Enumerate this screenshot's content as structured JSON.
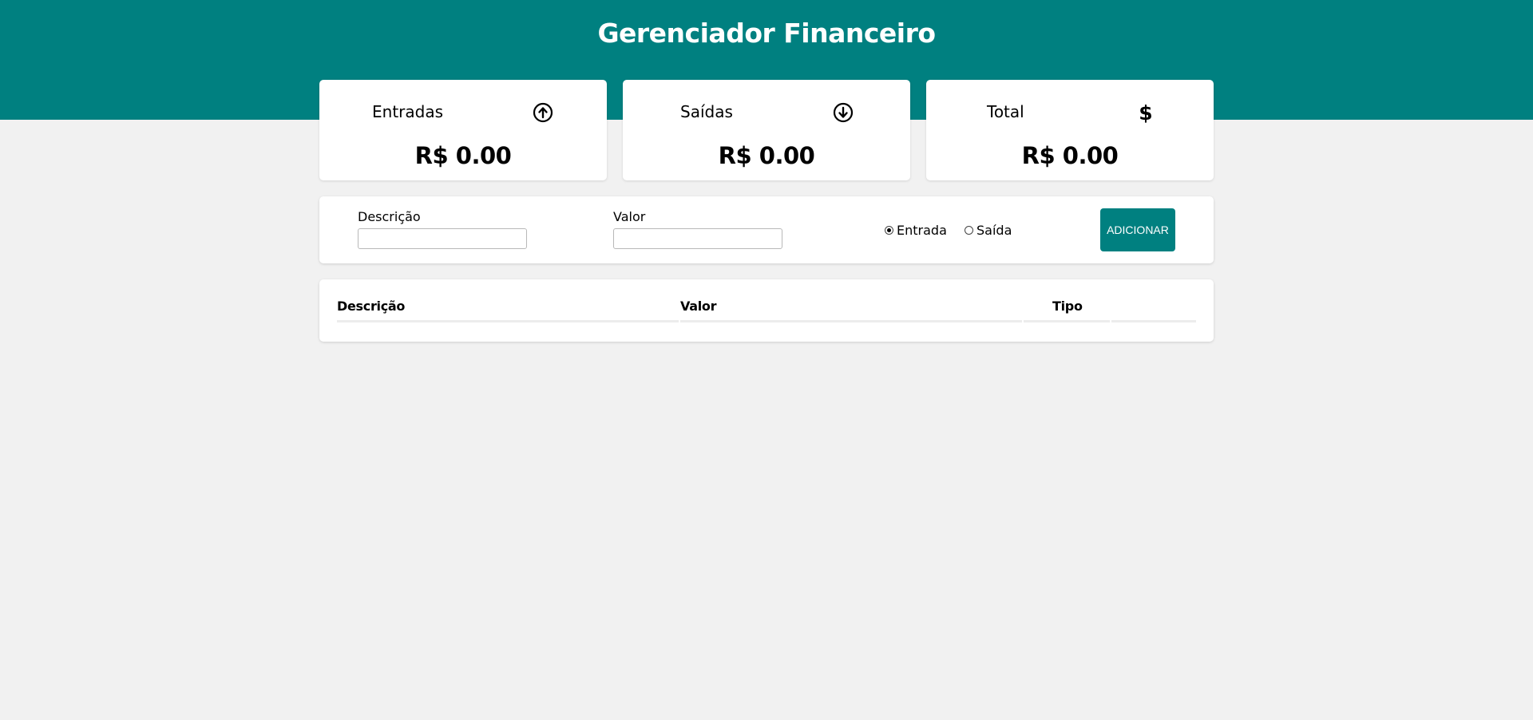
{
  "header": {
    "title": "Gerenciador Financeiro",
    "color": "#008080"
  },
  "summary": {
    "entradas": {
      "label": "Entradas",
      "value": "R$ 0.00",
      "icon": "arrow-up-circle-icon"
    },
    "saidas": {
      "label": "Saídas",
      "value": "R$ 0.00",
      "icon": "arrow-down-circle-icon"
    },
    "total": {
      "label": "Total",
      "value": "R$ 0.00",
      "icon": "dollar-icon"
    }
  },
  "form": {
    "descricao_label": "Descrição",
    "descricao_value": "",
    "valor_label": "Valor",
    "valor_value": "",
    "radio_entrada_label": "Entrada",
    "radio_saida_label": "Saída",
    "selected_type": "Entrada",
    "add_button_label": "ADICIONAR"
  },
  "table": {
    "columns": [
      "Descrição",
      "Valor",
      "Tipo",
      ""
    ],
    "rows": []
  }
}
